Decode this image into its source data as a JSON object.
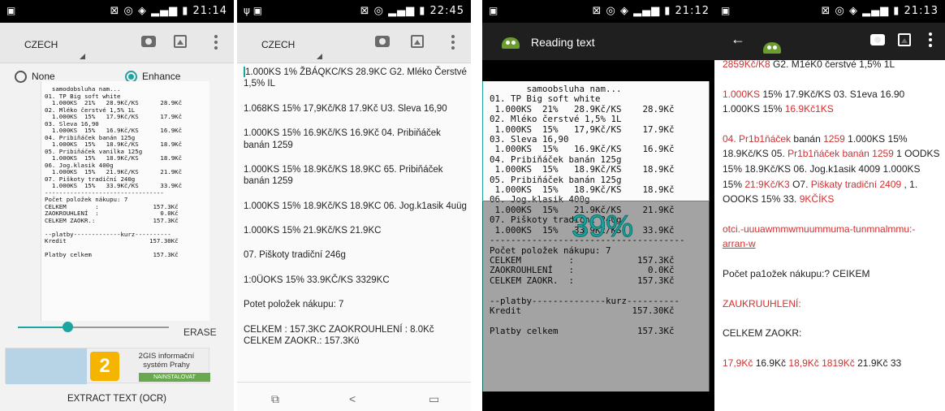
{
  "screens": [
    {
      "status_time": "21:14",
      "language": "CZECH",
      "radio_none": "None",
      "radio_enhance": "Enhance",
      "receipt_lines": "  samodobsluha nam...\n01. TP Big soft white\n  1.000KS  21%   28.9Kč/KS      28.9Kč\n02. Mléko čerstvé 1,5% 1L\n  1.000KS  15%   17.9Kč/KS      17.9Kč\n03. Sleva 16,90\n  1.000KS  15%   16.9Kč/KS      16.9Kč\n04. Pribiňáček banán 125g\n  1.000KS  15%   18.9Kč/KS      18.9Kč\n05. Pribiňáček vanilka 125g\n  1.000KS  15%   18.9Kč/KS      18.9Kč\n06. Jog.klasik 400g\n  1.000KS  15%   21.9Kč/KS      21.9Kč\n07. Piškoty tradiční 240g\n  1.000KS  15%   33.9Kč/KS      33.9Kč\n---------------------------------\nPočet položek nákupu: 7\nCELKEM        :               157.3Kč\nZAOKROUHLENÍ  :                 0.0Kč\nCELKEM ZAOKR.:                157.3Kč\n\n--platby-------------kurz----------\nKredit                       157.30Kč\n\nPlatby celkem                 157.3Kč",
      "erase": "ERASE",
      "ad_logo": "2",
      "ad_text": "2GIS informační systém Prahy",
      "ad_button": "NAINSTALOVAT",
      "extract": "EXTRACT TEXT (OCR)"
    },
    {
      "status_time": "22:45",
      "language": "CZECH",
      "paragraphs": [
        "1.000KS 1% ŽBÁQKC/KS 28.9KC G2. Mléko Čerstvé 1,5% IL",
        "1.068KS 15% 17,9Kč/K8 17.9Kč U3. Sleva 16,90",
        "1.000KS 15% 16.9Kč/KS 16.9Kč 04. Pribiňáček banán 1259",
        "1.000KS 15% 18.9Kč/KS 18.9KC 65. Pribiňáček banán 1259",
        "1.000KS 15% 18.9Kč/KS 18.9KC 06. Jog.k1asik 4uüg",
        "1.000KS 15% 21.9Kč/KS 21.9KC",
        "07. Piškoty tradiční 246g",
        "1:0ÜOKS 15% 33.9KČ/KS 3329KC",
        "Potet položek nákupu: 7",
        "CELKEM : 157.3KC ZAOKROUHLENÍ : 8.0Kč CELKEM ZAOKR.: 157.3Kö"
      ]
    },
    {
      "status_time": "21:12",
      "title": "Reading text",
      "progress": "39%",
      "progress_value": 0.39,
      "receipt_lines": "       samoobsluha nam...\n01. TP Big soft white\n 1.000KS  21%   28.9Kč/KS    28.9Kč\n02. Mléko čerstvé 1,5% 1L\n 1.000KS  15%   17,9Kč/KS    17.9Kč\n03. Sleva 16,90\n 1.000KS  15%   16.9Kč/KS    16.9Kč\n04. Pribiňáček banán 125g\n 1.000KS  15%   18.9Kč/KS    18.9Kč\n05. Pribiňáček banán 125g\n 1.000KS  15%   18.9Kč/KS    18.9Kč\n06. Jog.klasik 400g\n 1.000KS  15%   21.9Kč/KS    21.9Kč\n07. Piškoty tradiční 240g\n 1.000KS  15%   33.9Kč/KS    33.9Kč\n-------------------------------------\nPočet položek nákupu: 7\nCELKEM         :            157.3Kč\nZAOKROUHLENÍ   :              0.0Kč\nCELKEM ZAOKR.  :            157.3Kč\n\n--platby--------------kurz----------\nKredit                     157.30Kč\n\nPlatby celkem               157.3Kč"
    },
    {
      "status_time": "21:13",
      "p1_a": "2859Kč/K8",
      "p1_b": " G2. M1éK0 čerstvé 1,5% 1L",
      "p2_a": "1.000KS",
      "p2_b": " 15% 17.9Kč/KS 03. S1eva 16.90 1.000KS 15% ",
      "p2_c": "16.9Kč1KS",
      "p3_a": "04. Pr1b1ňáček",
      "p3_b": " banán ",
      "p3_c": "1259",
      "p3_d": " 1.000KS 15% 18.9Kč/KS 05. ",
      "p3_e": "Pr1b1ňáček banán 1259",
      "p3_f": " 1 OODKS 15% 18.9Kč/KS 06. Jog.k1asik 4009 1.000KS 15% ",
      "p3_g": "21:9Kč/K3",
      "p3_h": " O7. ",
      "p3_i": "Piškaty tradiční 2409",
      "p3_j": " , 1. OOOKS 15% 33. ",
      "p3_k": "9KČÍKS",
      "p4_a": "otci.-uuuawmmwmuummuma-tunmnalmmu:-",
      "p4_b": "arran-w",
      "p5": "Počet pa1ožek nákupu:? CEIKEM",
      "p6": "ZAUKRUUHLENÍ:",
      "p7": "CELKEM ZAOKR:",
      "p8_a": "17,9Kč",
      "p8_b": " 16.9Kč ",
      "p8_c": "18,9Kč",
      "p8_d": " ",
      "p8_e": "1819Kč",
      "p8_f": " 21.9Kč 33"
    }
  ]
}
